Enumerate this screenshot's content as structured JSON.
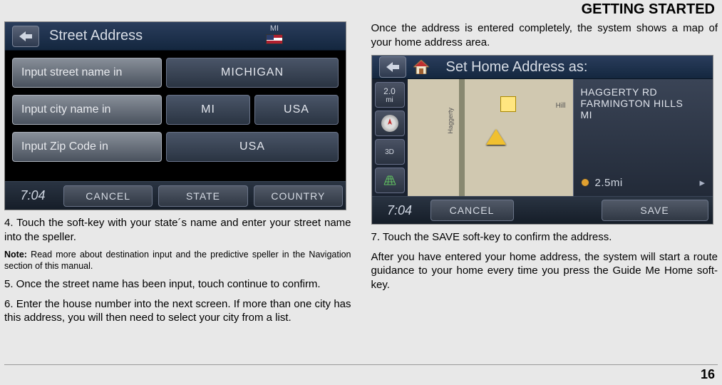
{
  "page": {
    "title": "GETTING STARTED",
    "number": "16"
  },
  "screen1": {
    "title": "Street Address",
    "state_abbrev": "MI",
    "rows": {
      "street": {
        "label": "Input street name in",
        "value1": "MICHIGAN"
      },
      "city": {
        "label": "Input city name in",
        "value1": "MI",
        "value2": "USA"
      },
      "zip": {
        "label": "Input Zip Code in",
        "value1": "USA"
      }
    },
    "clock": "7:04",
    "softkeys": {
      "cancel": "CANCEL",
      "state": "STATE",
      "country": "COUNTRY"
    }
  },
  "left_text": {
    "step4": "4. Touch the soft-key with your state´s name and enter your street name into the speller.",
    "note_label": "Note:",
    "note_body": " Read more about destination input and the predictive speller in the Navigation section of this manual.",
    "step5": "5. Once the street name has been input, touch continue to confirm.",
    "step6": "6. Enter the house number into the next screen. If more than one city has this address, you will then need to select your city from a list."
  },
  "right_text": {
    "intro": "Once the address is entered completely, the system shows a map of your home address area.",
    "step7": "7. Touch the SAVE soft-key to confirm the address.",
    "after": "After you have entered your home address, the system will start a route guidance to your home every time you press the Guide Me Home soft-key."
  },
  "screen2": {
    "title": "Set Home Address as:",
    "side": {
      "scale": "2.0",
      "scale_unit": "mi",
      "three_d": "3D"
    },
    "map": {
      "road_v": "Haggerty",
      "road_h": "Hill"
    },
    "address": {
      "line1": "HAGGERTY RD",
      "line2": "FARMINGTON HILLS",
      "line3": "MI",
      "distance": "2.5mi"
    },
    "clock": "7:04",
    "softkeys": {
      "cancel": "CANCEL",
      "save": "SAVE"
    }
  }
}
